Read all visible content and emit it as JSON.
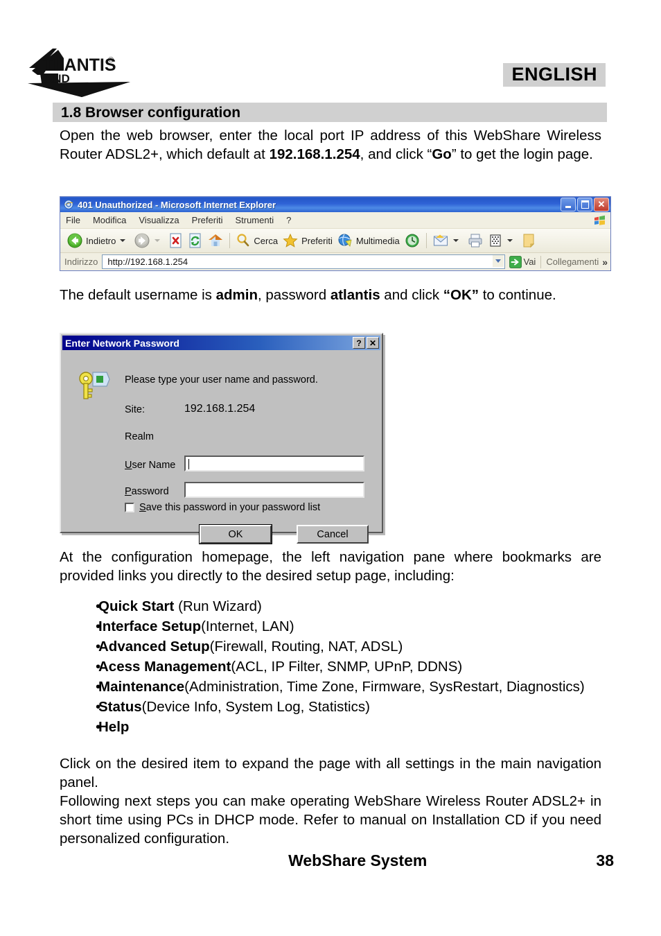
{
  "header": {
    "logo_text": "ATLANTIS",
    "logo_sub": "LAND",
    "logo_reg": "®",
    "language": "ENGLISH"
  },
  "section": {
    "heading": "1.8 Browser configuration"
  },
  "paragraphs": {
    "intro_1": "Open the web browser, enter the local port IP address of this WebShare Wireless Router ADSL2+, which default at ",
    "intro_ip": "192.168.1.254",
    "intro_2": ", and click “",
    "intro_go": "Go",
    "intro_3": "” to get the login page.",
    "creds_1": "The default username is ",
    "creds_user": "admin",
    "creds_2": ", password ",
    "creds_pass": "atlantis",
    "creds_3": " and click ",
    "creds_ok": "“OK”",
    "creds_4": " to continue.",
    "homepage": "At the configuration homepage, the left navigation pane where bookmarks are provided links you directly to the desired setup page, including:",
    "click_item": "Click on the desired item to expand the page with all settings in the main navigation panel.",
    "following": "Following next steps you can make operating WebShare Wireless Router ADSL2+ in short time using PCs  in DHCP mode.  Refer to manual on Installation CD if you need personalized configuration."
  },
  "browser": {
    "title": "401 Unauthorized - Microsoft Internet Explorer",
    "title_icon": "internet-explorer-icon",
    "caption": {
      "minimize": "minimize-button",
      "restore": "restore-button",
      "close": "close-button"
    },
    "menu": [
      "File",
      "Modifica",
      "Visualizza",
      "Preferiti",
      "Strumenti",
      "?"
    ],
    "toolbar": {
      "back": "Indietro",
      "search": "Cerca",
      "favorites": "Preferiti",
      "multimedia": "Multimedia"
    },
    "address": {
      "label": "Indirizzo",
      "url": "http://192.168.1.254",
      "go": "Vai",
      "links": "Collegamenti",
      "overflow": "»"
    }
  },
  "password_dialog": {
    "title": "Enter Network Password",
    "help_btn": "?",
    "close_btn": "✕",
    "prompt": "Please type your user name and password.",
    "site_label": "Site:",
    "site_value": "192.168.1.254",
    "realm_label": "Realm",
    "username_label_u": "U",
    "username_label_rest": "ser Name",
    "password_label_p": "P",
    "password_label_rest": "assword",
    "username_value": "",
    "password_value": "",
    "save_check_s": "S",
    "save_check_rest": "ave this password in your password list",
    "ok": "OK",
    "cancel": "Cancel"
  },
  "bullets": [
    {
      "mark": "•",
      "bold": "Quick Start",
      "rest": " (Run Wizard)"
    },
    {
      "mark": "•",
      "bold": "Interface Setup",
      "rest": "(Internet, LAN)"
    },
    {
      "mark": "•",
      "bold": "Advanced Setup",
      "rest": "(Firewall, Routing, NAT, ADSL)"
    },
    {
      "mark": "•",
      "bold": "Acess Management",
      "rest": "(ACL, IP Filter, SNMP, UPnP, DDNS)"
    },
    {
      "mark": "•",
      "bold": "Maintenance",
      "rest": "(Administration, Time Zone, Firmware, SysRestart, Diagnostics)"
    },
    {
      "mark": "•",
      "bold": "Status",
      "rest": "(Device Info, System Log, Statistics)"
    },
    {
      "mark": "•",
      "bold": "Help",
      "rest": ""
    }
  ],
  "footer": {
    "title": "WebShare System",
    "page": "38"
  },
  "colors": {
    "band_gray": "#d0d0d0",
    "ie_title_blue": "#2f63d6",
    "dialog_face": "#c0c0c0",
    "dialog_title_blue": "#00008b"
  }
}
